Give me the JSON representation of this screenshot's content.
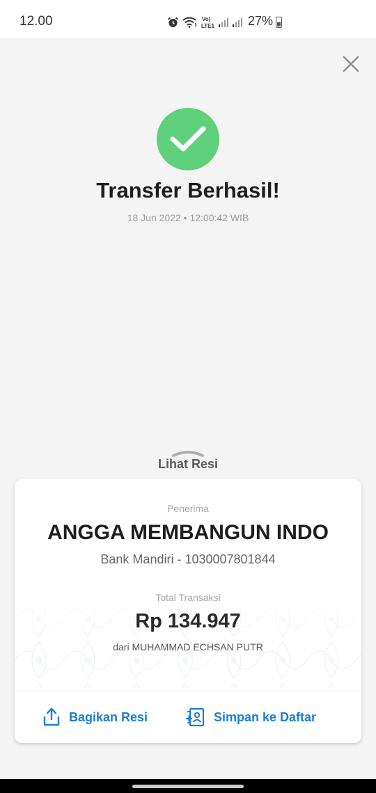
{
  "status_bar": {
    "time": "12.00",
    "battery": "27%",
    "icons": [
      "alarm-icon",
      "wifi-icon",
      "volte-icon",
      "signal-icon",
      "signal-icon",
      "battery-icon"
    ]
  },
  "header": {
    "close_icon": "close-icon"
  },
  "result": {
    "icon": "check-icon",
    "title": "Transfer Berhasil!",
    "datetime": "18 Jun 2022 • 12:00:42 WIB"
  },
  "receipt_toggle": {
    "label": "Lihat Resi",
    "icon": "chevron-up-icon"
  },
  "receipt": {
    "recipient_label": "Penerima",
    "recipient_name": "ANGGA MEMBANGUN INDO",
    "recipient_bank": "Bank Mandiri - 1030007801844",
    "total_label": "Total Transaksi",
    "total_amount": "Rp 134.947",
    "sender": "dari MUHAMMAD ECHSAN PUTR"
  },
  "actions": {
    "share_label": "Bagikan Resi",
    "share_icon": "share-icon",
    "save_label": "Simpan ke Daftar",
    "save_icon": "add-contact-icon"
  },
  "colors": {
    "success": "#5fd07b",
    "accent": "#1a7fd4",
    "background": "#f4f4f4"
  }
}
